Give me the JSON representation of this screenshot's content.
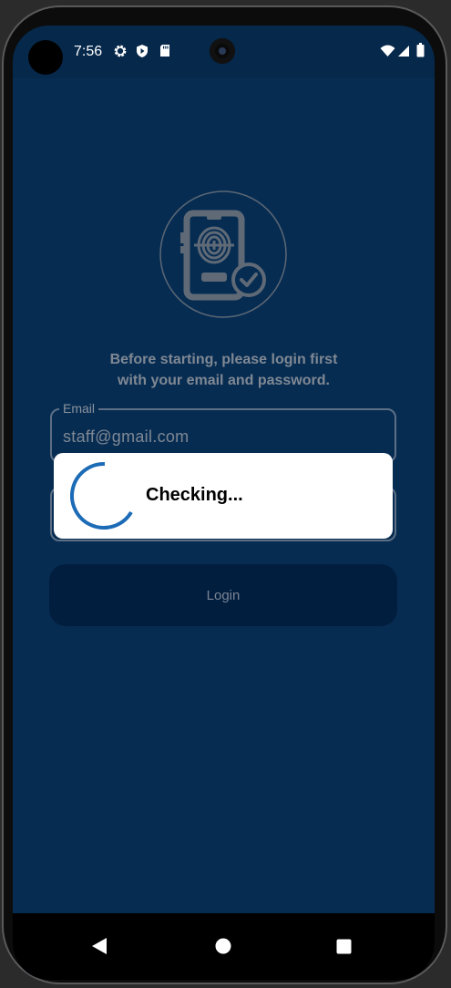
{
  "status_bar": {
    "time": "7:56",
    "left_icons": [
      "gear-icon",
      "shield-icon",
      "sd-card-icon"
    ],
    "right_icons": [
      "wifi-icon",
      "signal-icon",
      "battery-icon"
    ]
  },
  "login": {
    "instruction_line1": "Before starting, please login first",
    "instruction_line2": "with your email and password.",
    "email_label": "Email",
    "email_value": "staff@gmail.com",
    "login_button_label": "Login"
  },
  "dialog": {
    "message": "Checking..."
  },
  "nav": {
    "buttons": [
      "back-icon",
      "home-icon",
      "recents-icon"
    ]
  },
  "colors": {
    "background": "#072c52",
    "button": "#021e3f",
    "spinner": "#1c6bb6",
    "muted_text": "#7f8893"
  }
}
